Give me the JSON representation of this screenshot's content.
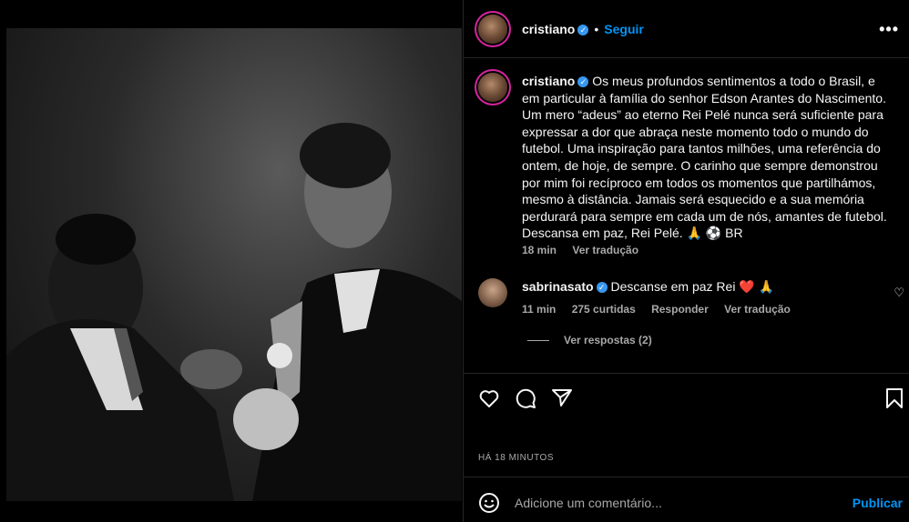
{
  "header": {
    "username": "cristiano",
    "follow_label": "Seguir",
    "dot": "•",
    "more": "•••"
  },
  "caption": {
    "username": "cristiano",
    "text": "Os meus profundos sentimentos a todo o Brasil, e em particular à família do senhor Edson Arantes do Nascimento. Um mero “adeus” ao eterno Rei Pelé nunca será suficiente para expressar a dor que abraça neste momento todo o mundo do futebol. Uma inspiração para tantos milhões, uma referência do ontem, de hoje, de sempre. O carinho que sempre demonstrou por mim foi recíproco em todos os momentos que partilhámos, mesmo à distância. Jamais será esquecido e a sua memória perdurará para sempre em cada um de nós, amantes de futebol. Descansa em paz, Rei Pelé. 🙏 ⚽ BR",
    "time": "18 min",
    "translate": "Ver tradução"
  },
  "comment": {
    "username": "sabrinasato",
    "text": "Descanse em paz Rei ❤️ 🙏",
    "time": "11 min",
    "likes": "275 curtidas",
    "reply": "Responder",
    "translate": "Ver tradução",
    "replies": "Ver respostas (2)"
  },
  "footer": {
    "timestamp": "HÁ 18 MINUTOS",
    "comment_placeholder": "Adicione um comentário...",
    "publish": "Publicar"
  },
  "colors": {
    "accent": "#0095f6",
    "verified": "#3897f0",
    "muted": "#a8a8a8",
    "background": "#000000"
  }
}
